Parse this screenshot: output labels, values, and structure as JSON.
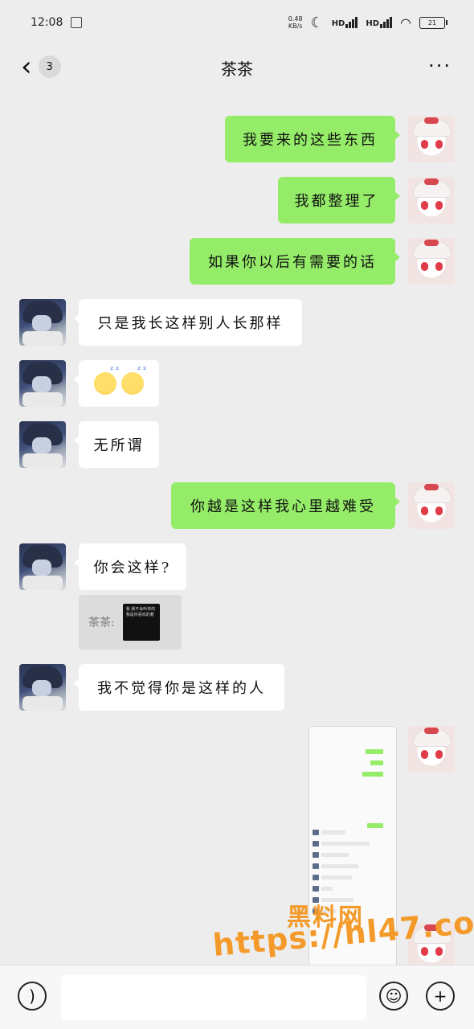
{
  "status_bar": {
    "time": "12:08",
    "net_speed_value": "0.48",
    "net_speed_unit": "KB/s",
    "signal_1": "HD",
    "signal_2": "HD",
    "battery": "21"
  },
  "header": {
    "back_badge": "3",
    "title": "茶茶",
    "more": "···"
  },
  "messages": [
    {
      "side": "me",
      "text": "我要来的这些东西"
    },
    {
      "side": "me",
      "text": "我都整理了"
    },
    {
      "side": "me",
      "text": "如果你以后有需要的话"
    },
    {
      "side": "them",
      "text": "只是我长这样别人长那样"
    },
    {
      "side": "them",
      "emoji": "sleeping-face-x2"
    },
    {
      "side": "them",
      "text": "无所谓"
    },
    {
      "side": "me",
      "text": "你越是这样我心里越难受"
    },
    {
      "side": "them",
      "text": "你会这样?"
    },
    {
      "side": "them",
      "quote_label": "茶茶:",
      "quote_snippet": "我 我不会听你的 我是你喜欢的着"
    },
    {
      "side": "them",
      "text": "我不觉得你是这样的人"
    },
    {
      "side": "me",
      "image": "chat-screenshot"
    }
  ],
  "watermark": {
    "top": "黑料网",
    "url": "https://hl47.co"
  },
  "composer": {
    "voice_icon": "voice-icon",
    "emoji_icon": "emoji-icon",
    "plus_icon": "plus-icon",
    "input_value": ""
  }
}
